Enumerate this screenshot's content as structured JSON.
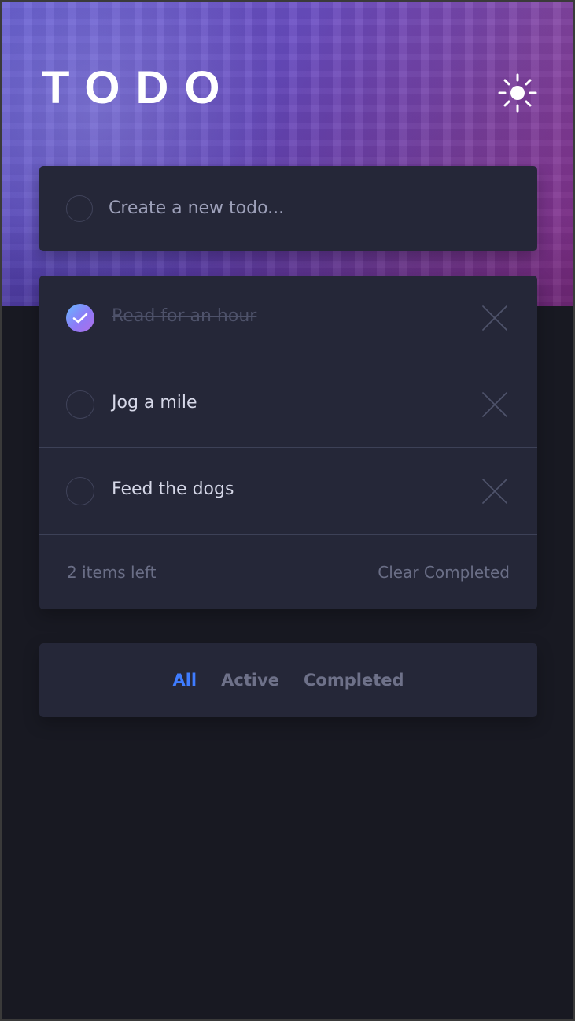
{
  "header": {
    "title": "TODO",
    "theme_icon": "sun-icon"
  },
  "new_todo": {
    "placeholder": "Create a new todo...",
    "value": ""
  },
  "todos": [
    {
      "text": "Read for an hour",
      "completed": true
    },
    {
      "text": "Jog a mile",
      "completed": false
    },
    {
      "text": "Feed the dogs",
      "completed": false
    }
  ],
  "summary": {
    "items_left": "2 items left",
    "clear_completed": "Clear Completed"
  },
  "filters": {
    "all": "All",
    "active": "Active",
    "completed": "Completed",
    "selected": "All"
  },
  "colors": {
    "accent": "#3f7cff",
    "completed_check_start": "#67b8ff",
    "completed_check_end": "#b06ee7"
  }
}
